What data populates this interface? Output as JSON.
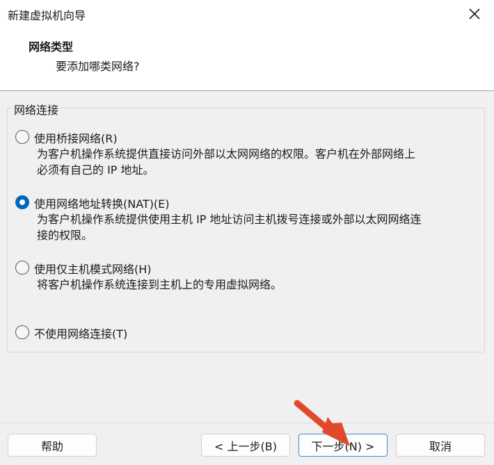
{
  "window": {
    "title": "新建虚拟机向导",
    "close_icon": "close-icon"
  },
  "header": {
    "title": "网络类型",
    "subtitle": "要添加哪类网络?"
  },
  "group": {
    "label": "网络连接"
  },
  "options": [
    {
      "label": "使用桥接网络(R)",
      "desc": [
        "为客户机操作系统提供直接访问外部以太网网络的权限。客户机在外部网络上",
        "必须有自己的 IP 地址。"
      ],
      "checked": false
    },
    {
      "label": "使用网络地址转换(NAT)(E)",
      "desc": [
        "为客户机操作系统提供使用主机 IP 地址访问主机拨号连接或外部以太网网络连",
        "接的权限。"
      ],
      "checked": true
    },
    {
      "label": "使用仅主机模式网络(H)",
      "desc": [
        "将客户机操作系统连接到主机上的专用虚拟网络。"
      ],
      "checked": false
    },
    {
      "label": "不使用网络连接(T)",
      "desc": [],
      "checked": false
    }
  ],
  "footer": {
    "help_label": "帮助",
    "back_label": "< 上一步(B)",
    "next_label": "下一步(N) >",
    "cancel_label": "取消"
  },
  "colors": {
    "accent": "#0067c0",
    "annotation_arrow": "#e04a2a"
  }
}
